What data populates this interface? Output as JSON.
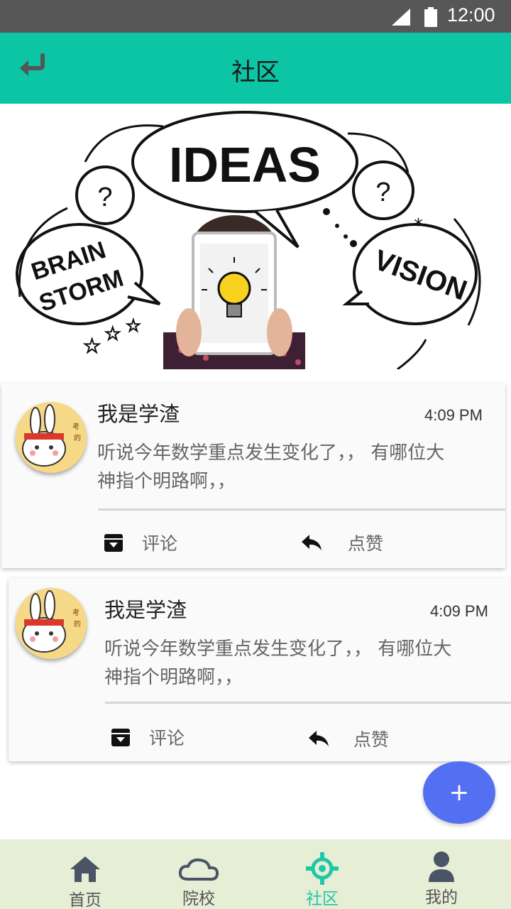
{
  "status_bar": {
    "time": "12:00"
  },
  "header": {
    "title": "社区"
  },
  "banner": {
    "words": {
      "ideas": "IDEAS",
      "brain": "BRAIN",
      "storm": "STORM",
      "vision": "VISION"
    }
  },
  "posts": [
    {
      "author": "我是学渣",
      "time": "4:09 PM",
      "content_line1": "听说今年数学重点发生变化了，，  有哪位大",
      "content_line2": "神指个明路啊，，",
      "comment_label": "评论",
      "like_label": "点赞"
    },
    {
      "author": "我是学渣",
      "time": "4:09 PM",
      "content_line1": "听说今年数学重点发生变化了，，  有哪位大",
      "content_line2": "神指个明路啊，，",
      "comment_label": "评论",
      "like_label": "点赞"
    }
  ],
  "fab": {
    "label": "+"
  },
  "bottom_nav": {
    "active": "社区",
    "active_color": "#1fc7a8",
    "items": [
      {
        "label": "首页",
        "icon": "home-icon"
      },
      {
        "label": "院校",
        "icon": "cloud-icon"
      },
      {
        "label": "社区",
        "icon": "crosshair-icon"
      },
      {
        "label": "我的",
        "icon": "person-icon"
      }
    ]
  },
  "colors": {
    "app_bar": "#0bc5a5",
    "status_bar": "#575757",
    "fab": "#5470f2",
    "bottom_nav": "#e6eed5"
  }
}
